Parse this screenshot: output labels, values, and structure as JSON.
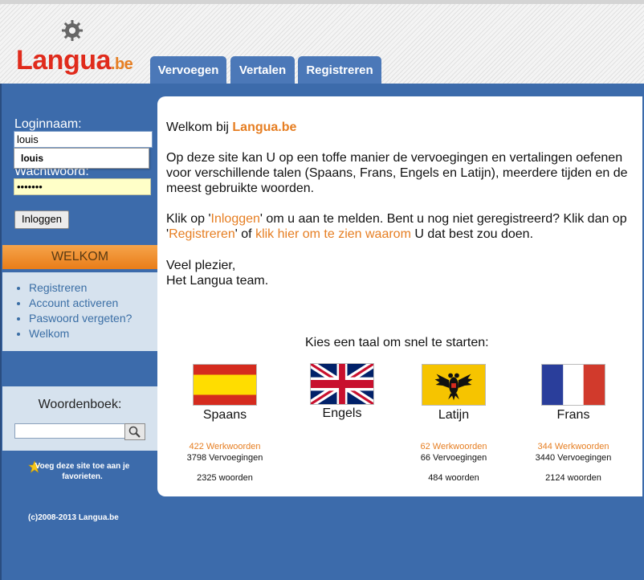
{
  "header": {
    "logo_main": "Langua",
    "logo_tld": ".be",
    "tabs": [
      {
        "label": "Vervoegen"
      },
      {
        "label": "Vertalen"
      },
      {
        "label": "Registreren"
      }
    ]
  },
  "login": {
    "username_label": "Loginnaam:",
    "username_value": "louis",
    "autocomplete_suggestion": "louis",
    "password_label": "Wachtwoord:",
    "password_value": "•••••••",
    "login_button": "Inloggen"
  },
  "welkom": {
    "title": "WELKOM",
    "links": [
      "Registreren",
      "Account activeren",
      "Paswoord vergeten?",
      "Welkom"
    ]
  },
  "dictionary": {
    "label": "Woordenboek:"
  },
  "favorites_text": "Voeg deze site toe aan je favorieten.",
  "copyright": "(c)2008-2013 Langua.be",
  "main": {
    "welcome_prefix": "Welkom bij ",
    "welcome_site": "Langua.be",
    "intro": "Op deze site kan U op een toffe manier de vervoegingen en vertalingen oefenen voor verschillende talen (Spaans, Frans, Engels en Latijn), meerdere tijden en de meest gebruikte woorden.",
    "p2_a": "Klik op '",
    "p2_login_link": "Inloggen",
    "p2_b": "' om u aan te melden. Bent u nog niet geregistreerd? Klik dan op '",
    "p2_register_link": "Registreren",
    "p2_c": "' of ",
    "p2_why_link": "klik hier om te zien waarom",
    "p2_d": " U dat best zou doen.",
    "closing_1": "Veel plezier,",
    "closing_2": "Het Langua team.",
    "choose_language": "Kies een taal om snel te starten:"
  },
  "languages": [
    {
      "name": "Spaans",
      "werkwoorden": "422 Werkwoorden",
      "vervoegingen": "3798 Vervoegingen",
      "woorden": "2325 woorden"
    },
    {
      "name": "Engels",
      "werkwoorden": "",
      "vervoegingen": "",
      "woorden": ""
    },
    {
      "name": "Latijn",
      "werkwoorden": "62 Werkwoorden",
      "vervoegingen": "66 Vervoegingen",
      "woorden": "484 woorden"
    },
    {
      "name": "Frans",
      "werkwoorden": "344 Werkwoorden",
      "vervoegingen": "3440 Vervoegingen",
      "woorden": "2124 woorden"
    }
  ],
  "colors": {
    "brand_blue": "#3c6bab",
    "brand_orange": "#e67e22",
    "logo_red": "#e02b1c"
  }
}
